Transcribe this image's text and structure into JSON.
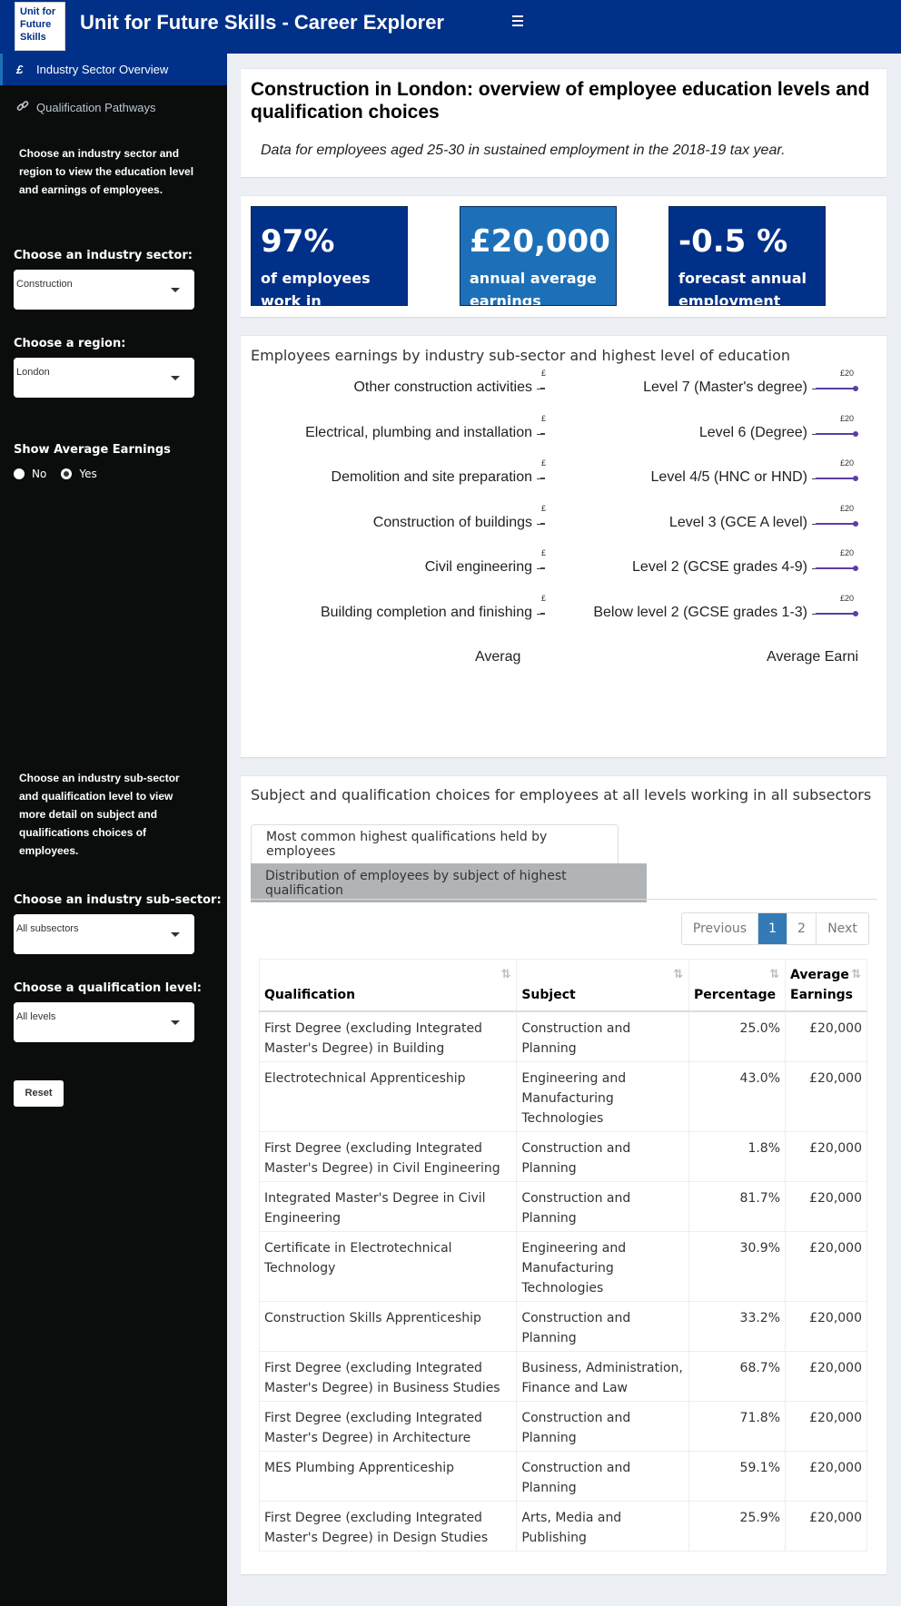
{
  "header": {
    "logo_lines": [
      "Unit for",
      "Future",
      "Skills"
    ],
    "title": "Unit for Future Skills - Career Explorer"
  },
  "sidebar": {
    "menu": [
      {
        "label": "Industry Sector Overview",
        "icon": "pound-icon",
        "active": true
      },
      {
        "label": "Qualification Pathways",
        "icon": "link-icon",
        "active": false
      }
    ],
    "intro_text": "Choose an industry sector and region to view the education level and earnings of employees.",
    "sector_label": "Choose an industry sector:",
    "sector_value": "Construction",
    "region_label": "Choose a region:",
    "region_value": "London",
    "avg_earnings_label": "Show Average Earnings",
    "radio_no": "No",
    "radio_yes": "Yes",
    "radio_selected": "Yes",
    "detail_text": "Choose an industry sub-sector and qualification level to view more detail on subject and qualifications choices of employees.",
    "subsector_label": "Choose an industry sub-sector:",
    "subsector_value": "All subsectors",
    "qual_label": "Choose a qualification level:",
    "qual_value": "All levels",
    "reset_label": "Reset"
  },
  "overview": {
    "title": "Construction in London: overview of employee education levels and qualification choices",
    "subtitle": "Data for employees aged 25-30 in sustained employment in the 2018-19 tax year."
  },
  "value_boxes": [
    {
      "value": "97%",
      "label": "of employees work in construction",
      "color": "#003087"
    },
    {
      "value": "£20,000",
      "label": "annual average earnings",
      "color": "#1d70b8"
    },
    {
      "value": "-0.5 %",
      "label": "forecast annual employment decline",
      "color": "#003087"
    }
  ],
  "chart_section": {
    "title": "Employees earnings by industry sub-sector and highest level of education"
  },
  "chart_data": [
    {
      "type": "bar",
      "categories": [
        "Other construction activities",
        "Electrical, plumbing and installation",
        "Demolition and site preparation",
        "Construction of buildings",
        "Civil engineering",
        "Building completion and finishing"
      ],
      "values": [
        20000,
        20000,
        20000,
        20000,
        20000,
        20000
      ],
      "value_labels": [
        "£",
        "£",
        "£",
        "£",
        "£",
        "£"
      ],
      "xlabel": "Average Ea"
    },
    {
      "type": "bar",
      "categories": [
        "Level 7 (Master's degree)",
        "Level 6 (Degree)",
        "Level 4/5 (HNC or HND)",
        "Level 3 (GCE A level)",
        "Level 2 (GCSE grades 4-9)",
        "Below level 2 (GCSE grades 1-3)"
      ],
      "values": [
        20000,
        20000,
        20000,
        20000,
        20000,
        20000
      ],
      "value_labels": [
        "£20",
        "£20",
        "£20",
        "£20",
        "£20",
        "£20"
      ],
      "xlabel": "Average Earnin",
      "color": "#5b3da6"
    }
  ],
  "table_section": {
    "title": "Subject and qualification choices for employees at all levels working in all subsectors",
    "tabs": [
      "Most common highest qualifications held by employees",
      "Distribution of employees by subject of highest qualification"
    ],
    "pager": {
      "previous": "Previous",
      "pages": [
        "1",
        "2"
      ],
      "current": "1",
      "next": "Next"
    },
    "columns": [
      "Qualification",
      "Subject",
      "Percentage",
      "Average Earnings"
    ],
    "rows": [
      {
        "qualification": "First Degree (excluding Integrated Master's Degree) in Building",
        "subject": "Construction and Planning",
        "percentage": "25.0%",
        "earnings": "£20,000"
      },
      {
        "qualification": "Electrotechnical Apprenticeship",
        "subject": "Engineering and Manufacturing Technologies",
        "percentage": "43.0%",
        "earnings": "£20,000"
      },
      {
        "qualification": "First Degree (excluding Integrated Master's Degree) in Civil Engineering",
        "subject": "Construction and Planning",
        "percentage": "1.8%",
        "earnings": "£20,000"
      },
      {
        "qualification": "Integrated Master's Degree in Civil Engineering",
        "subject": "Construction and Planning",
        "percentage": "81.7%",
        "earnings": "£20,000"
      },
      {
        "qualification": "Certificate in Electrotechnical Technology",
        "subject": "Engineering and Manufacturing Technologies",
        "percentage": "30.9%",
        "earnings": "£20,000"
      },
      {
        "qualification": "Construction Skills Apprenticeship",
        "subject": "Construction and Planning",
        "percentage": "33.2%",
        "earnings": "£20,000"
      },
      {
        "qualification": "First Degree (excluding Integrated Master's Degree) in Business Studies",
        "subject": "Business, Administration, Finance and Law",
        "percentage": "68.7%",
        "earnings": "£20,000"
      },
      {
        "qualification": "First Degree (excluding Integrated Master's Degree) in Architecture",
        "subject": "Construction and Planning",
        "percentage": "71.8%",
        "earnings": "£20,000"
      },
      {
        "qualification": "MES Plumbing Apprenticeship",
        "subject": "Construction and Planning",
        "percentage": "59.1%",
        "earnings": "£20,000"
      },
      {
        "qualification": "First Degree (excluding Integrated Master's Degree) in Design Studies",
        "subject": "Arts, Media and Publishing",
        "percentage": "25.9%",
        "earnings": "£20,000"
      }
    ]
  }
}
